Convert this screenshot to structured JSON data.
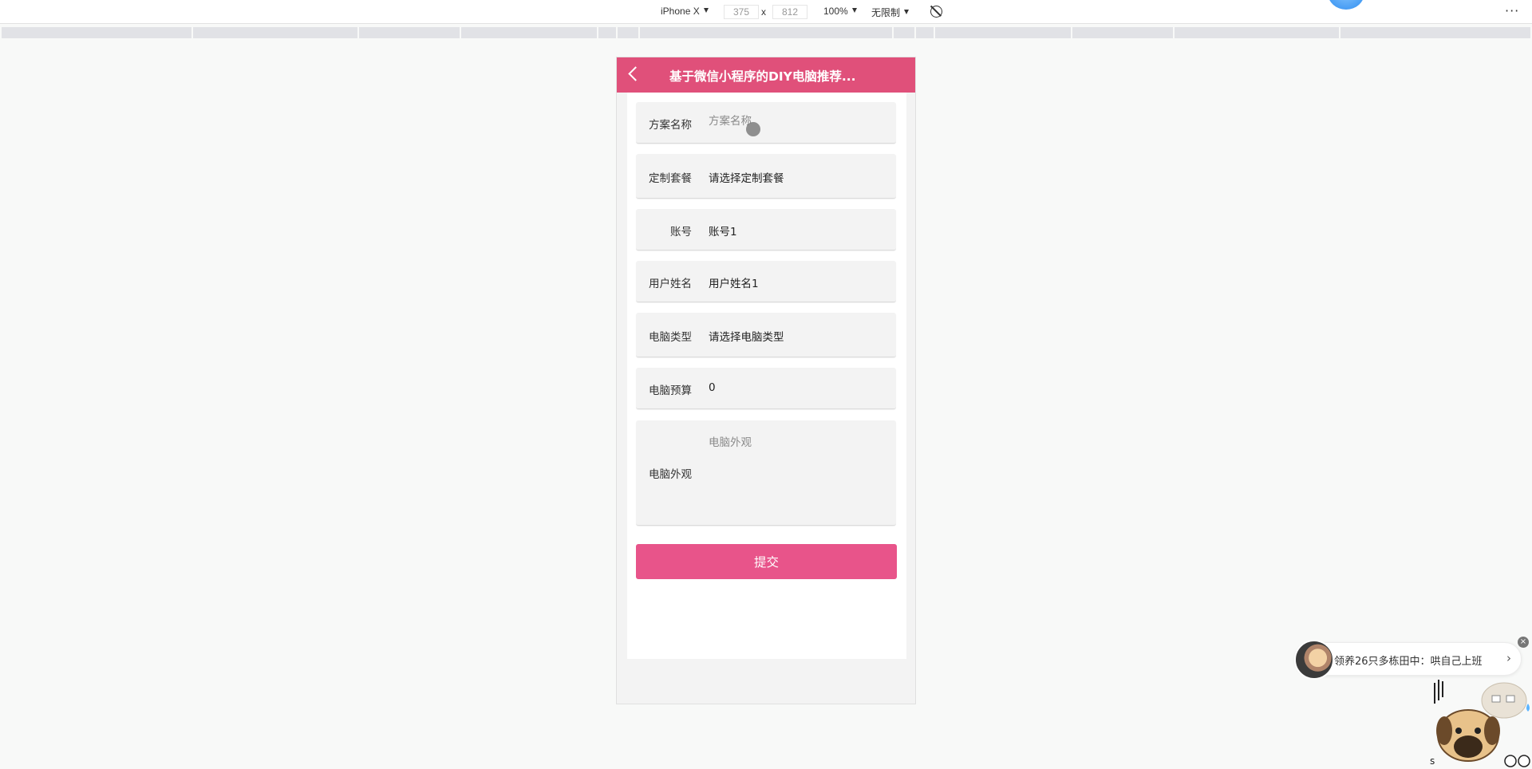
{
  "toolbar": {
    "device": "iPhone X",
    "width": "375",
    "separator": "x",
    "height": "812",
    "zoom": "100%",
    "throttle": "无限制",
    "more": "···"
  },
  "nav": {
    "title": "基于微信小程序的DIY电脑推荐..."
  },
  "form": {
    "plan_name": {
      "label": "方案名称",
      "placeholder": "方案名称"
    },
    "package": {
      "label": "定制套餐",
      "value": "请选择定制套餐"
    },
    "account": {
      "label": "账号",
      "value": "账号1"
    },
    "username": {
      "label": "用户姓名",
      "value": "用户姓名1"
    },
    "computer_type": {
      "label": "电脑类型",
      "value": "请选择电脑类型"
    },
    "budget": {
      "label": "电脑预算",
      "value": "0"
    },
    "appearance": {
      "label": "电脑外观",
      "placeholder": "电脑外观"
    },
    "submit": "提交"
  },
  "widget": {
    "text": "领养26只多栋田中：哄自己上班",
    "arrow": "›",
    "close": "×"
  }
}
